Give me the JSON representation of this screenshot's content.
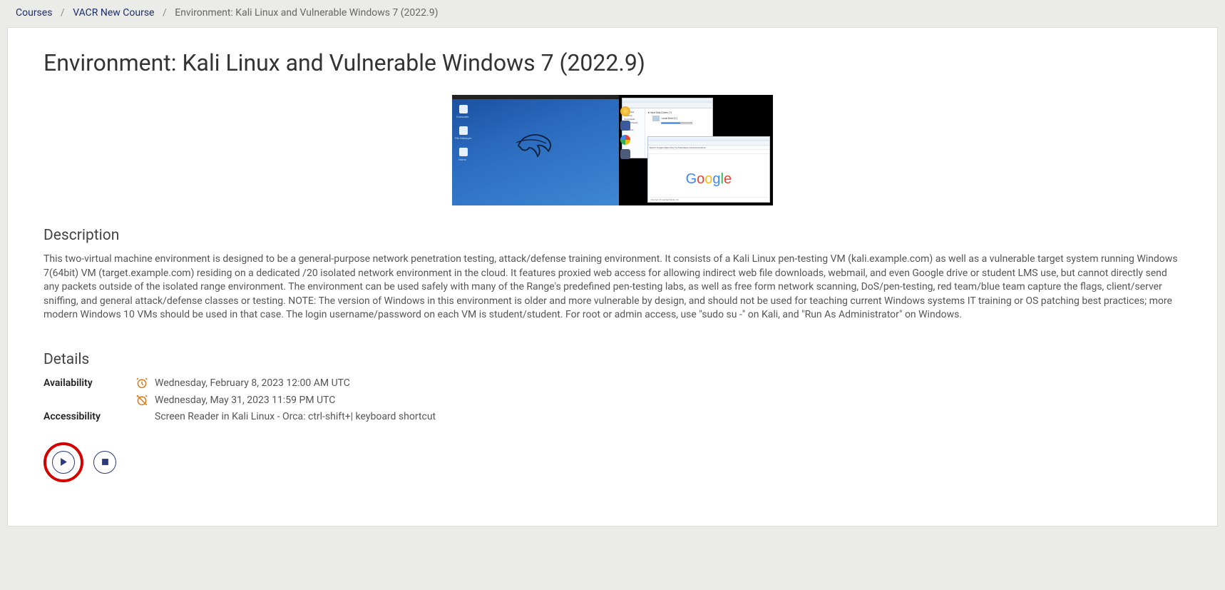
{
  "breadcrumb": {
    "courses": "Courses",
    "parent": "VACR New Course",
    "current": "Environment: Kali Linux and Vulnerable Windows 7 (2022.9)"
  },
  "page": {
    "title": "Environment: Kali Linux and Vulnerable Windows 7 (2022.9)"
  },
  "description": {
    "heading": "Description",
    "body": "This two-virtual machine environment is designed to be a general-purpose network penetration testing, attack/defense training environment. It consists of a Kali Linux pen-testing VM (kali.example.com) as well as a vulnerable target system running Windows 7(64bit) VM (target.example.com) residing on a dedicated /20 isolated network environment in the cloud. It features proxied web access for allowing indirect web file downloads, webmail, and even Google drive or student LMS use, but cannot directly send any packets outside of the isolated range environment. The environment can be used safely with many of the Range's predefined pen-testing labs, as well as free form network scanning, DoS/pen-testing, red team/blue team capture the flags, client/server sniffing, and general attack/defense classes or testing. NOTE: The version of Windows in this environment is older and more vulnerable by design, and should not be used for teaching current Windows systems IT training or OS patching best practices; more modern Windows 10 VMs should be used in that case. The login username/password on each VM is student/student. For root or admin access, use \"sudo su -\" on Kali, and \"Run As Administrator\" on Windows."
  },
  "details": {
    "heading": "Details",
    "availability_label": "Availability",
    "availability_start": "Wednesday, February 8, 2023 12:00 AM UTC",
    "availability_end": "Wednesday, May 31, 2023 11:59 PM UTC",
    "accessibility_label": "Accessibility",
    "accessibility_value": "Screen Reader in Kali Linux - Orca: ctrl-shift+| keyboard shortcut"
  },
  "controls": {
    "play": "Play",
    "stop": "Stop"
  }
}
